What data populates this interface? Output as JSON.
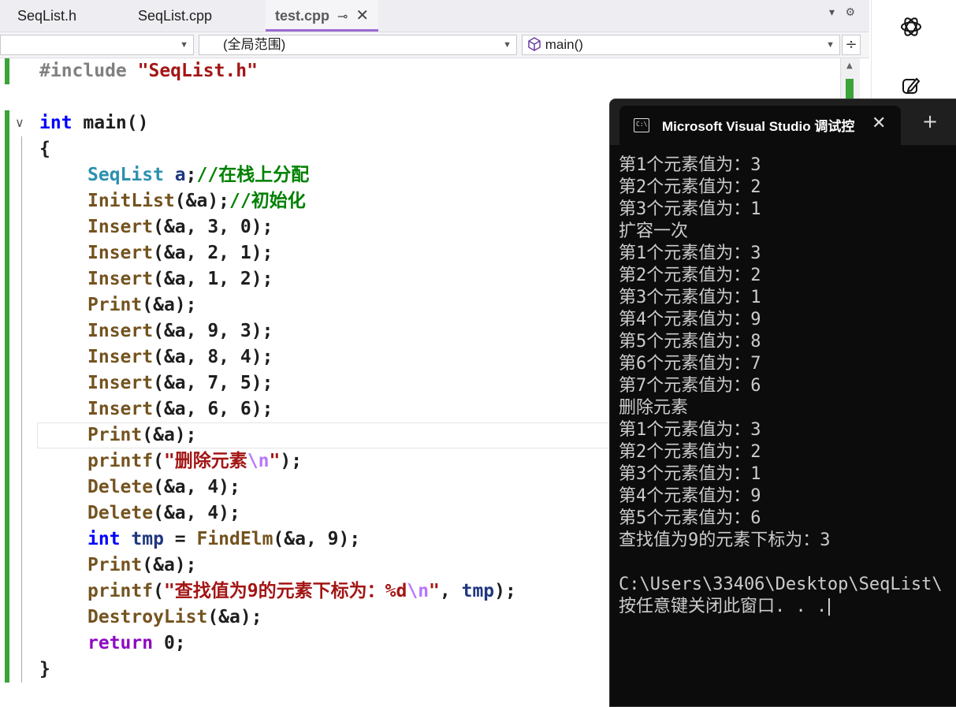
{
  "tabs": [
    {
      "label": "SeqList.h",
      "active": false
    },
    {
      "label": "SeqList.cpp",
      "active": false
    },
    {
      "label": "test.cpp",
      "active": true
    }
  ],
  "tab_icons": {
    "pin": "⊸",
    "close": "✕",
    "dropdown": "▾",
    "settings": "⚙"
  },
  "navbar": {
    "project_combo": "",
    "scope_combo": "(全局范围)",
    "member_combo": "main()"
  },
  "code": {
    "include_kw": "#include",
    "include_file": "\"SeqList.h\"",
    "main_kw": "int",
    "main_sig": " main()",
    "open_brace": "{",
    "close_brace": "}",
    "l_seqlist_type": "SeqList",
    "l_seqlist_var": " a",
    "l_seqlist_semi": ";",
    "l_seqlist_comment": "//在栈上分配",
    "l_init_fn": "InitList",
    "l_init_args": "(&a);",
    "l_init_comment": "//初始化",
    "insert_fn": "Insert",
    "inserts_a": [
      "(&a, 3, 0);",
      "(&a, 2, 1);",
      "(&a, 1, 2);"
    ],
    "print_fn": "Print",
    "print_args": "(&a);",
    "inserts_b": [
      "(&a, 9, 3);",
      "(&a, 8, 4);",
      "(&a, 7, 5);",
      "(&a, 6, 6);"
    ],
    "printf_fn": "printf",
    "printf1_open": "(",
    "printf1_str": "\"删除元素",
    "printf1_esc": "\\n",
    "printf1_close_str": "\"",
    "printf1_end": ");",
    "delete_fn": "Delete",
    "delete_args": "(&a, 4);",
    "tmp_kw": "int",
    "tmp_var": " tmp",
    "tmp_eq": " = ",
    "findelm_fn": "FindElm",
    "findelm_args": "(&a, 9);",
    "printf2_str": "\"查找值为9的元素下标为：%d",
    "printf2_end_a": ", ",
    "printf2_var": "tmp",
    "printf2_end_b": ");",
    "destroy_fn": "DestroyList",
    "destroy_args": "(&a);",
    "return_kw": "return",
    "return_val": " 0;"
  },
  "console": {
    "title": "Microsoft Visual Studio 调试控",
    "icon": "C:\\",
    "lines": [
      "第1个元素值为：3",
      "第2个元素值为：2",
      "第3个元素值为：1",
      "扩容一次",
      "第1个元素值为：3",
      "第2个元素值为：2",
      "第3个元素值为：1",
      "第4个元素值为：9",
      "第5个元素值为：8",
      "第6个元素值为：7",
      "第7个元素值为：6",
      "删除元素",
      "第1个元素值为：3",
      "第2个元素值为：2",
      "第3个元素值为：1",
      "第4个元素值为：9",
      "第5个元素值为：6",
      "查找值为9的元素下标为：3",
      "",
      "C:\\Users\\33406\\Desktop\\SeqList\\",
      "按任意键关闭此窗口. . ."
    ]
  },
  "side_icons": [
    "chatgpt-icon",
    "edit-icon"
  ],
  "colors": {
    "accent": "#9b6bd1",
    "changebar": "#3aa33a",
    "console_bg": "#0c0c0c"
  }
}
